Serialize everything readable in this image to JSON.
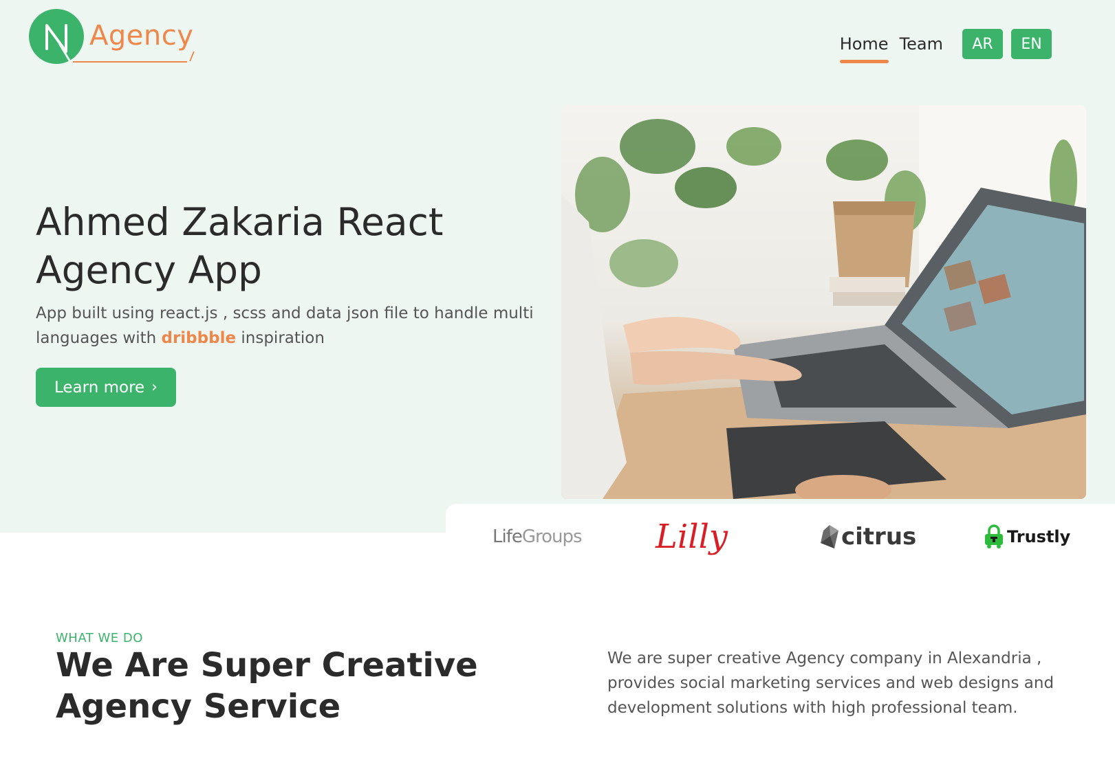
{
  "header": {
    "logo": {
      "mark_letter": "N",
      "text": "Agency"
    },
    "nav": [
      {
        "label": "Home",
        "active": true
      },
      {
        "label": "Team",
        "active": false
      }
    ],
    "languages": [
      "AR",
      "EN"
    ]
  },
  "hero": {
    "title": "Ahmed Zakaria React Agency App",
    "description_before": "App built using react.js , scss and data json file to handle multi languages with ",
    "description_link": "dribbble",
    "description_after": " inspiration",
    "cta_label": "Learn more",
    "cta_icon": "chevron-right-icon",
    "image_alt": "person working on a laptop at a desk with plants"
  },
  "brands": [
    {
      "name": "LifeGroups",
      "part1": "Life",
      "part2": "Groups"
    },
    {
      "name": "Lilly"
    },
    {
      "name": "citrus"
    },
    {
      "name": "Trustly"
    }
  ],
  "what_we_do": {
    "tag": "WHAT WE DO",
    "title": "We Are Super Creative Agency Service",
    "description": "We are super creative Agency company in Alexandria , provides social marketing services and web designs and development solutions with high professional team."
  },
  "colors": {
    "primary_green": "#3bb36a",
    "accent_orange": "#f0874a",
    "hero_background": "#eef6f2",
    "lilly_red": "#d81f26"
  }
}
